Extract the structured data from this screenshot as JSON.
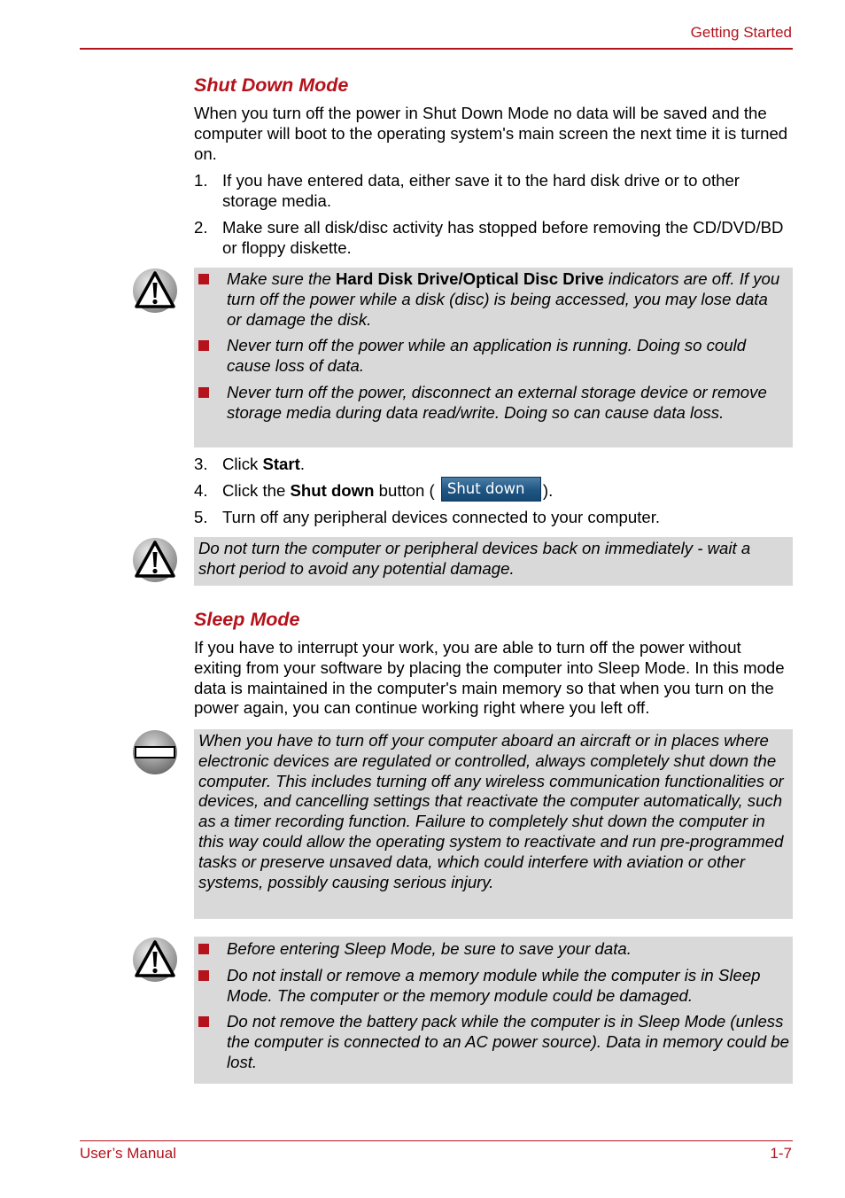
{
  "header": {
    "section": "Getting Started"
  },
  "footer": {
    "left": "User’s Manual",
    "page": "1-7"
  },
  "colors": {
    "accent": "#b5121b",
    "note_bg": "#d9d9d9"
  },
  "shutdown": {
    "title": "Shut Down Mode",
    "intro": "When you turn off the power in Shut Down Mode no data will be saved and the computer will boot to the operating system's main screen the next time it is turned on.",
    "steps_a": [
      {
        "num": "1.",
        "text": "If you have entered data, either save it to the hard disk drive or to other storage media."
      },
      {
        "num": "2.",
        "text": "Make sure all disk/disc activity has stopped before removing the CD/DVD/BD or floppy diskette."
      }
    ],
    "caution1": {
      "icon": "warning-triangle-icon",
      "item1_pre": "Make sure the ",
      "item1_bold": "Hard Disk Drive/Optical Disc Drive",
      "item1_post": " indicators are off. If you turn off the power while a disk (disc) is being accessed, you may lose data or damage the disk.",
      "item2": "Never turn off the power while an application is running. Doing so could cause loss of data.",
      "item3": "Never turn off the power, disconnect an external storage device or remove storage media during data read/write. Doing so can cause data loss."
    },
    "step3": {
      "num": "3.",
      "pre": "Click ",
      "bold": "Start",
      "post": "."
    },
    "step4": {
      "num": "4.",
      "pre": "Click the ",
      "bold": "Shut down",
      "mid": " button ( ",
      "button_label": "Shut down",
      "post": ")."
    },
    "step5": {
      "num": "5.",
      "text": "Turn off any peripheral devices connected to your computer."
    },
    "caution2": {
      "icon": "warning-triangle-icon",
      "text": "Do not turn the computer or peripheral devices back on immediately - wait a short period to avoid any potential damage."
    }
  },
  "sleep": {
    "title": "Sleep Mode",
    "intro": "If you have to interrupt your work, you are able to turn off the power without exiting from your software by placing the computer into Sleep Mode. In this mode data is maintained in the computer's main memory so that when you turn on the power again, you can continue working right where you left off.",
    "prohibited": {
      "icon": "prohibited-icon",
      "text": "When you have to turn off your computer aboard an aircraft or in places where electronic devices are regulated or controlled, always completely shut down the computer. This includes turning off any wireless communication functionalities or devices, and cancelling settings that reactivate the computer automatically, such as a timer recording function. Failure to completely shut down the computer in this way could allow the operating system to reactivate and run pre-programmed tasks or preserve unsaved data, which could interfere with aviation or other systems, possibly causing serious injury."
    },
    "caution3": {
      "icon": "warning-triangle-icon",
      "items": [
        "Before entering Sleep Mode, be sure to save your data.",
        "Do not install or remove a memory module while the computer is in Sleep Mode. The computer or the memory module could be damaged.",
        "Do not remove the battery pack while the computer is in Sleep Mode (unless the computer is connected to an AC power source). Data in memory could be lost."
      ]
    }
  }
}
